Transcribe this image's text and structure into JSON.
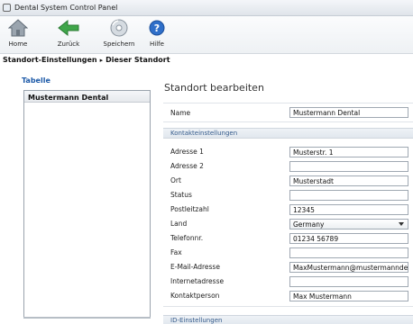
{
  "window": {
    "title": "Dental System Control Panel"
  },
  "toolbar": {
    "home_label": "Home",
    "back_label": "Zurück",
    "save_label": "Speichern",
    "help_label": "Hilfe"
  },
  "breadcrumb": {
    "parent": "Standort-Einstellungen",
    "separator": "▸",
    "current": "Dieser Standort"
  },
  "list": {
    "tab_label": "Tabelle",
    "items": [
      "Mustermann Dental"
    ]
  },
  "form": {
    "title": "Standort bearbeiten",
    "name_label": "Name",
    "name_value": "Mustermann Dental",
    "contact_section": "Kontakteinstellungen",
    "fields": [
      {
        "label": "Adresse 1",
        "value": "Musterstr. 1"
      },
      {
        "label": "Adresse 2",
        "value": ""
      },
      {
        "label": "Ort",
        "value": "Musterstadt"
      },
      {
        "label": "Status",
        "value": ""
      },
      {
        "label": "Postleitzahl",
        "value": "12345"
      },
      {
        "label": "Land",
        "value": "Germany"
      },
      {
        "label": "Telefonnr.",
        "value": "01234 56789"
      },
      {
        "label": "Fax",
        "value": ""
      },
      {
        "label": "E-Mail-Adresse",
        "value": "MaxMustermann@mustermanndental.de"
      },
      {
        "label": "Internetadresse",
        "value": ""
      },
      {
        "label": "Kontaktperson",
        "value": "Max Mustermann"
      }
    ],
    "id_section": "ID-Einstellungen"
  },
  "colors": {
    "accent": "#1d5aa8",
    "section_text": "#355b8c"
  }
}
